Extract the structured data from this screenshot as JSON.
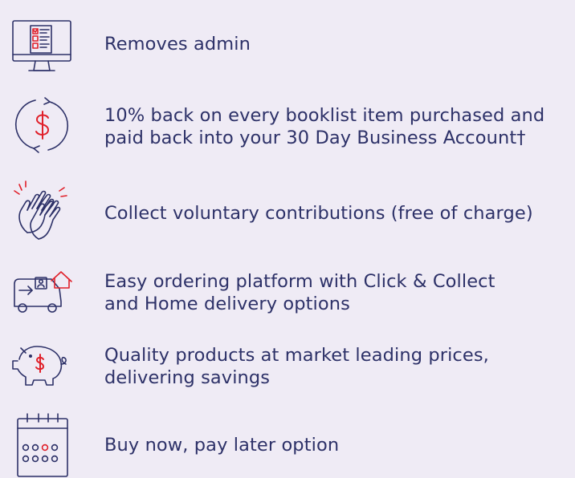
{
  "colors": {
    "background": "#efebf5",
    "navy": "#2d3168",
    "red": "#e0202a"
  },
  "benefits": [
    {
      "icon": "computer-checklist-icon",
      "lines": [
        "Removes admin"
      ]
    },
    {
      "icon": "dollar-cycle-icon",
      "lines": [
        "10% back on every booklist item purchased and",
        "paid back into your 30 Day Business Account†"
      ]
    },
    {
      "icon": "clapping-hands-icon",
      "lines": [
        "Collect voluntary contributions (free of charge)"
      ]
    },
    {
      "icon": "delivery-van-home-icon",
      "lines": [
        "Easy ordering platform with Click & Collect",
        "and Home delivery options"
      ]
    },
    {
      "icon": "piggy-bank-icon",
      "lines": [
        "Quality products at market leading prices,",
        "delivering savings"
      ]
    },
    {
      "icon": "calendar-icon",
      "lines": [
        "Buy now, pay later option"
      ]
    }
  ]
}
